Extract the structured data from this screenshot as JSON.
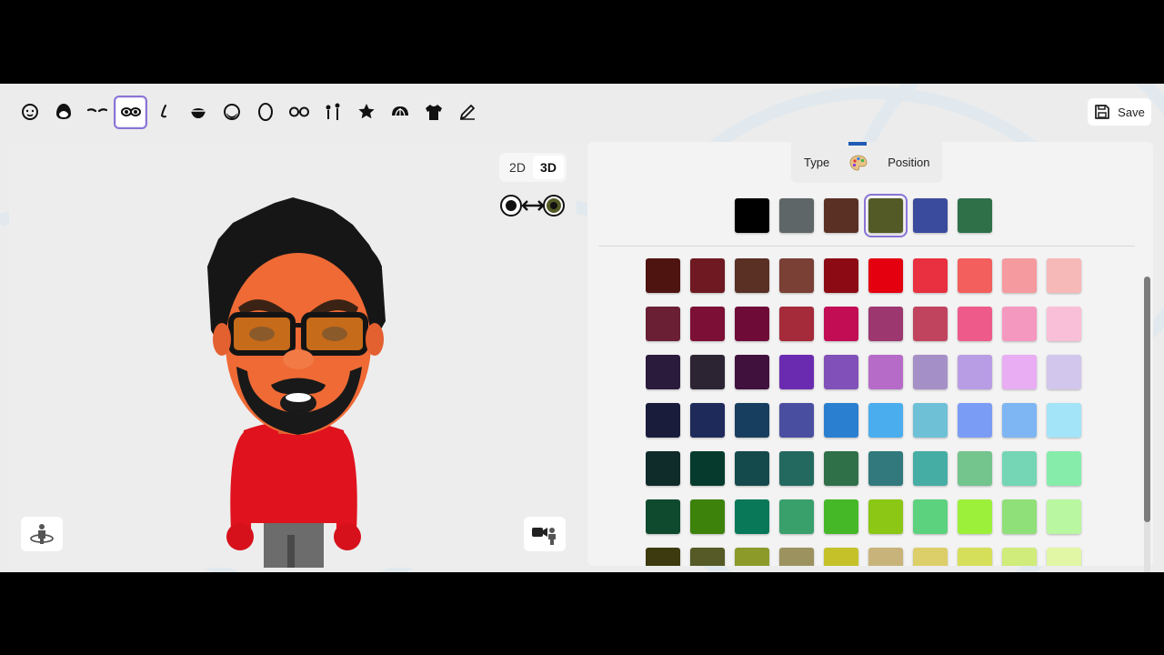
{
  "toolbar": {
    "items": [
      {
        "icon": "face-shape-icon"
      },
      {
        "icon": "hair-icon"
      },
      {
        "icon": "eyebrows-icon"
      },
      {
        "icon": "eyes-icon",
        "selected": true
      },
      {
        "icon": "nose-icon"
      },
      {
        "icon": "mouth-icon"
      },
      {
        "icon": "beard-icon"
      },
      {
        "icon": "ears-icon"
      },
      {
        "icon": "glasses-icon"
      },
      {
        "icon": "height-icon"
      },
      {
        "icon": "favorite-star-icon"
      },
      {
        "icon": "hat-icon"
      },
      {
        "icon": "shirt-icon"
      },
      {
        "icon": "edit-pencil-icon"
      }
    ],
    "save_label": "Save"
  },
  "preview": {
    "mode_2d": "2D",
    "mode_3d": "3D",
    "active_mode": "3D",
    "eye_toggle_icon": "eye-swap-icon",
    "rotate_icon": "rotate-avatar-icon",
    "camera_icon": "camera-pose-icon"
  },
  "panel": {
    "tabs": {
      "type_label": "Type",
      "color_icon": "palette-icon",
      "position_label": "Position",
      "active": "color"
    },
    "primary_colors": [
      "#000000",
      "#5f6668",
      "#5a3025",
      "#545a26",
      "#3a4a9c",
      "#2f7049"
    ],
    "selected_primary": 3,
    "palette": [
      [
        "#4e1410",
        "#6f1a22",
        "#5a3025",
        "#7a3f35",
        "#8c0a14",
        "#e4000f",
        "#e83040",
        "#f25f5c",
        "#f59a9e",
        "#f7b8b8"
      ],
      [
        "#6a1f34",
        "#7c0f35",
        "#6e0b36",
        "#a52a3a",
        "#c20d54",
        "#9c3770",
        "#c0445e",
        "#ee5b8b",
        "#f598c0",
        "#f9bfd8"
      ],
      [
        "#2a1b3c",
        "#2c2433",
        "#40113d",
        "#6a2bb0",
        "#8150b8",
        "#b66bc8",
        "#a58fc7",
        "#b89de4",
        "#e8adf3",
        "#d3c6ec"
      ],
      [
        "#1a1c3c",
        "#1e2a5a",
        "#173e5e",
        "#4a4ea0",
        "#2b7fd0",
        "#4aadee",
        "#6ec0d7",
        "#7b9cf5",
        "#7db6f3",
        "#a3e4f8"
      ],
      [
        "#0f2b2a",
        "#053a2c",
        "#154a4d",
        "#246960",
        "#2f7049",
        "#31797d",
        "#46ada4",
        "#74c48d",
        "#74d6b4",
        "#86ecaa"
      ],
      [
        "#0f4a2f",
        "#3d820b",
        "#087859",
        "#39a06c",
        "#45b828",
        "#8bc714",
        "#5dd27e",
        "#9cf03a",
        "#8fe078",
        "#b9f7a0"
      ],
      [
        "#3d3a10",
        "#555a26",
        "#8c9a2a",
        "#9c9260",
        "#c4c228",
        "#c8b47a",
        "#dccf6a",
        "#d6df5a",
        "#d0ec7a",
        "#e2f7a6"
      ]
    ]
  }
}
